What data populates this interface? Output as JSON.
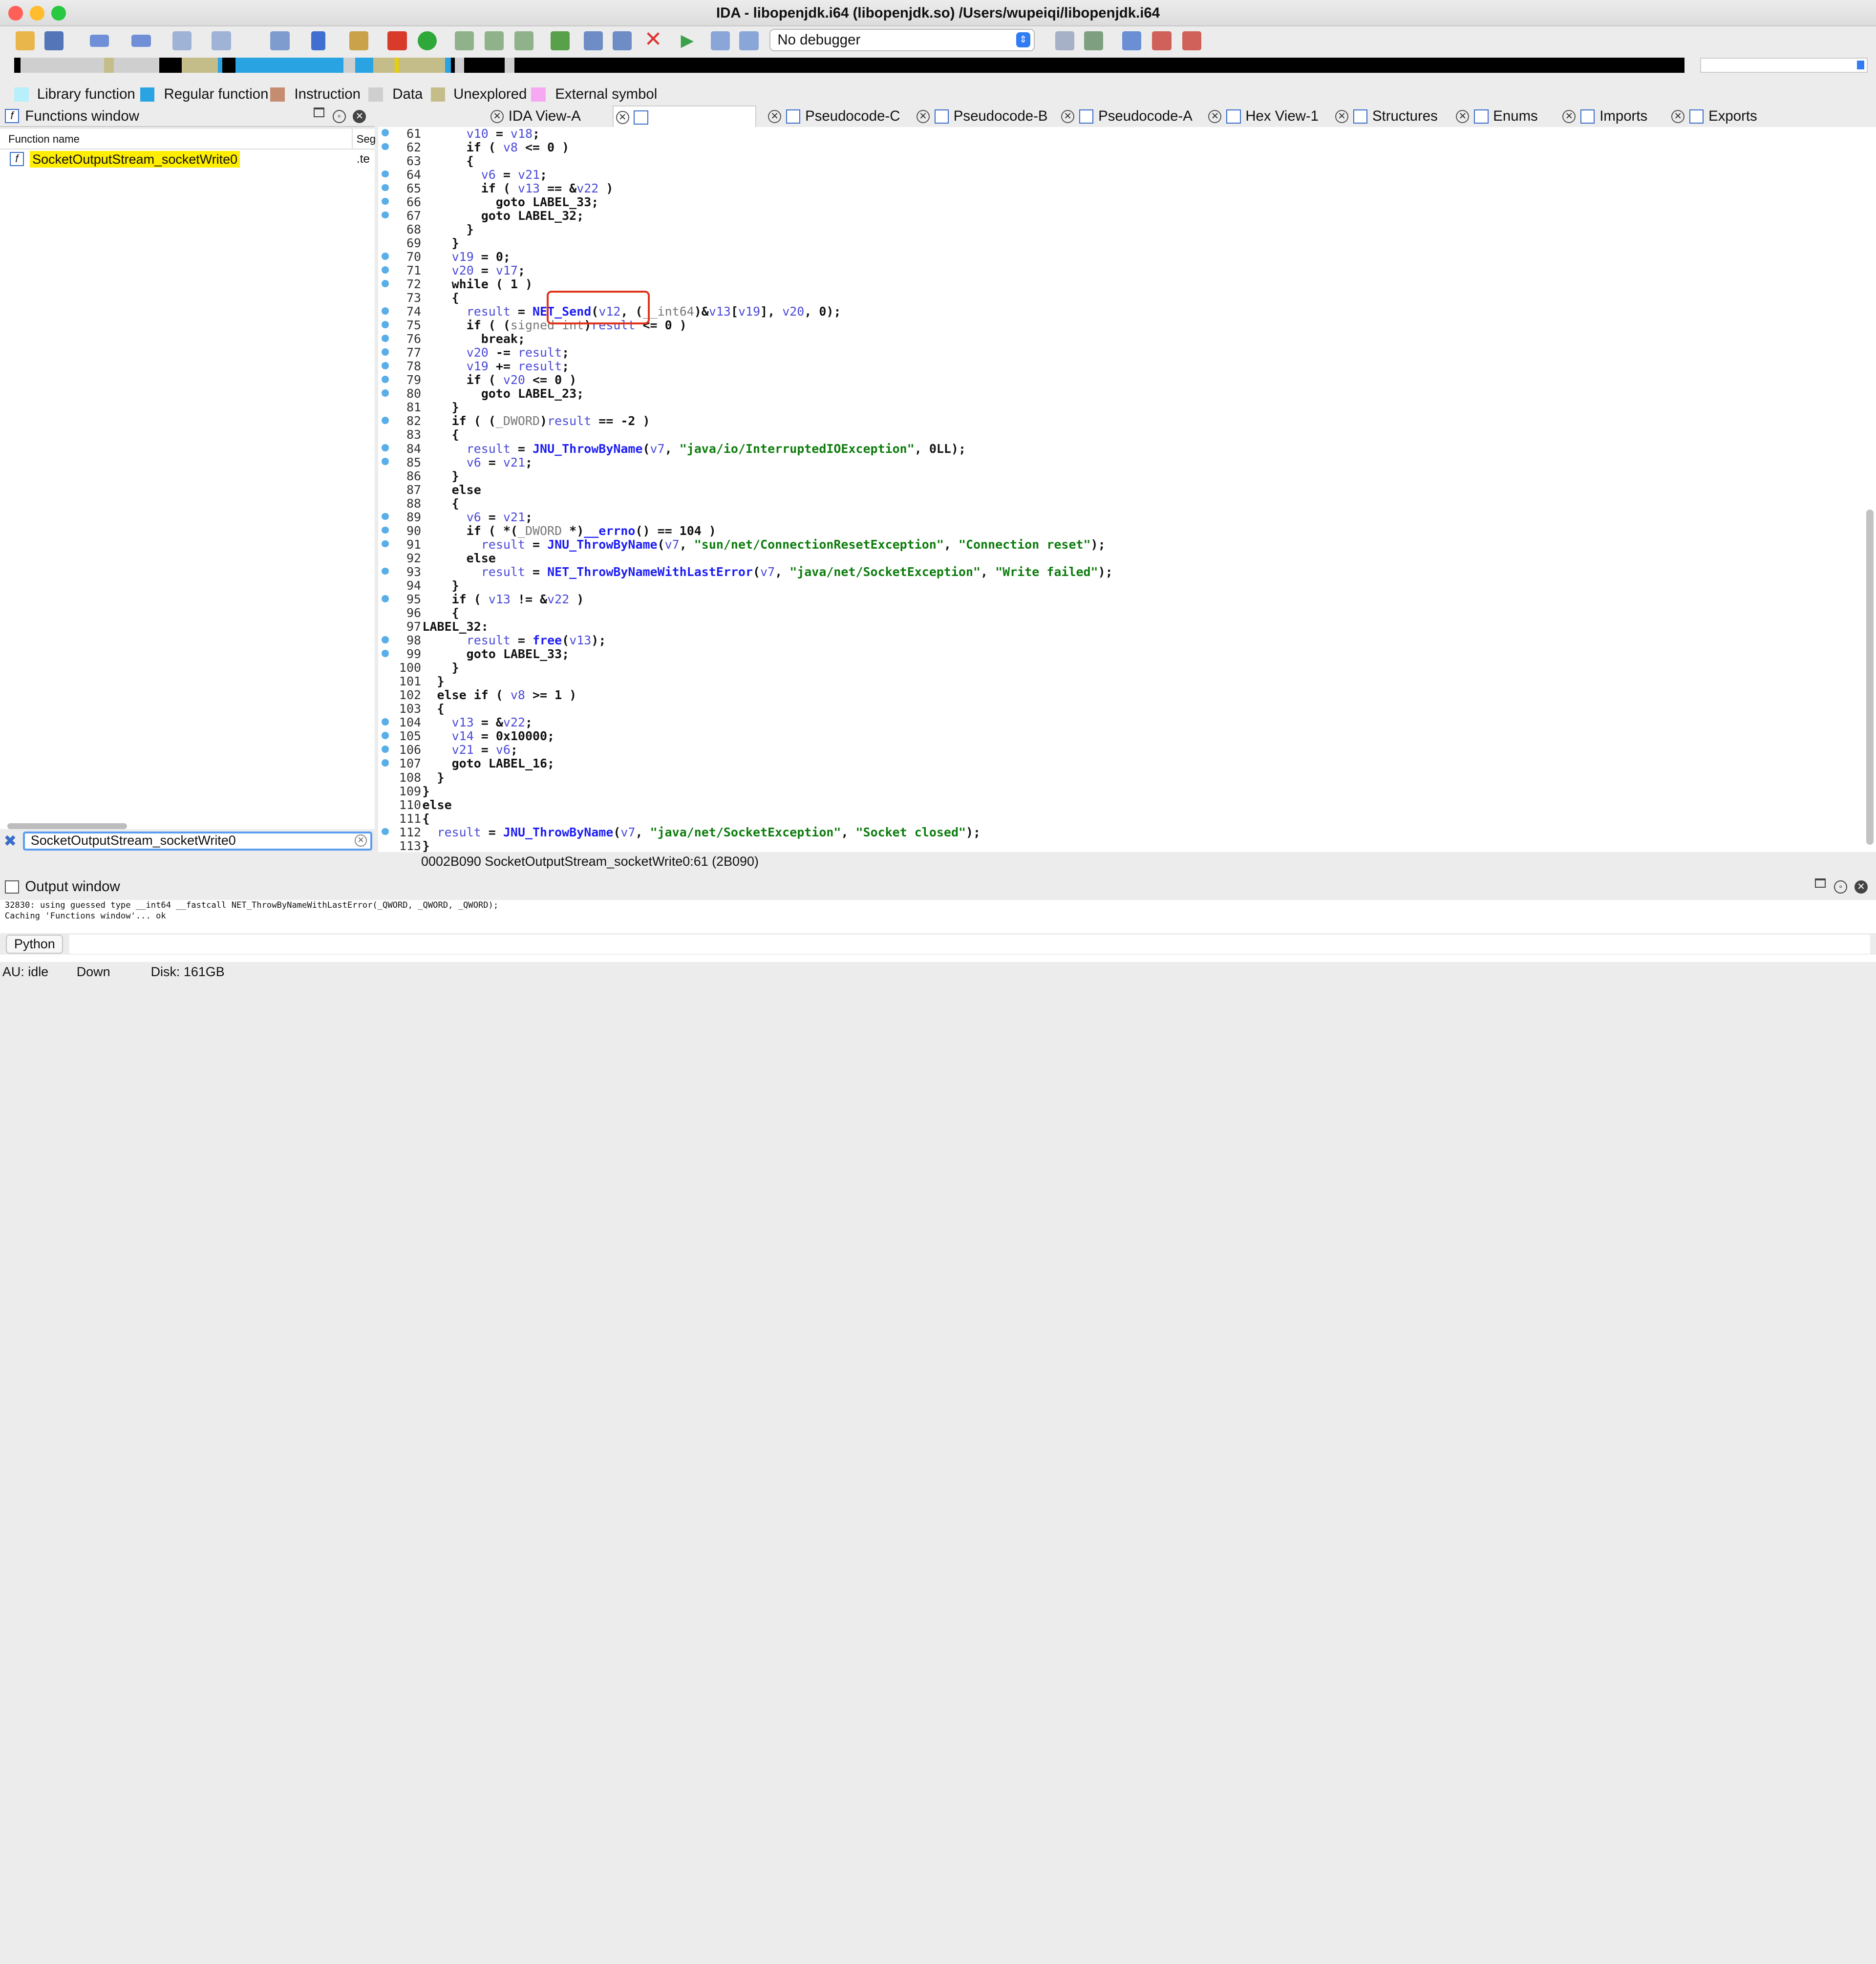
{
  "window": {
    "title": "IDA - libopenjdk.i64 (libopenjdk.so) /Users/wupeiqi/libopenjdk.i64"
  },
  "toolbar": {
    "debugger_select": "No debugger"
  },
  "legend": [
    {
      "label": "Library function",
      "color": "#b7f0fb"
    },
    {
      "label": "Regular function",
      "color": "#2aa3e3"
    },
    {
      "label": "Instruction",
      "color": "#c58c70"
    },
    {
      "label": "Data",
      "color": "#cfcfcf"
    },
    {
      "label": "Unexplored",
      "color": "#c4bd8a"
    },
    {
      "label": "External symbol",
      "color": "#f7a8f2"
    }
  ],
  "functions_window": {
    "title": "Functions window",
    "col_name": "Function name",
    "col_seg": "Seg",
    "rows": [
      {
        "name": "SocketOutputStream_socketWrite0",
        "seg": ".te"
      }
    ],
    "filter_value": "SocketOutputStream_socketWrite0"
  },
  "tabs": [
    {
      "label": "IDA View-A"
    },
    {
      "label": ""
    },
    {
      "label": "Pseudocode-C"
    },
    {
      "label": "Pseudocode-B"
    },
    {
      "label": "Pseudocode-A"
    },
    {
      "label": "Hex View-1"
    },
    {
      "label": "Structures"
    },
    {
      "label": "Enums"
    },
    {
      "label": "Imports"
    },
    {
      "label": "Exports"
    }
  ],
  "code": {
    "lines": [
      {
        "n": "61",
        "bp": true,
        "t": "      v10 = v18;"
      },
      {
        "n": "62",
        "bp": true,
        "t": "      if ( v8 <= 0 )"
      },
      {
        "n": "63",
        "bp": false,
        "t": "      {"
      },
      {
        "n": "64",
        "bp": true,
        "t": "        v6 = v21;"
      },
      {
        "n": "65",
        "bp": true,
        "t": "        if ( v13 == &v22 )"
      },
      {
        "n": "66",
        "bp": true,
        "t": "          goto LABEL_33;"
      },
      {
        "n": "67",
        "bp": true,
        "t": "        goto LABEL_32;"
      },
      {
        "n": "68",
        "bp": false,
        "t": "      }"
      },
      {
        "n": "69",
        "bp": false,
        "t": "    }"
      },
      {
        "n": "70",
        "bp": true,
        "t": "    v19 = 0;"
      },
      {
        "n": "71",
        "bp": true,
        "t": "    v20 = v17;"
      },
      {
        "n": "72",
        "bp": true,
        "t": "    while ( 1 )"
      },
      {
        "n": "73",
        "bp": false,
        "t": "    {"
      },
      {
        "n": "74",
        "bp": true,
        "t": "      result = NET_Send(v12, (__int64)&v13[v19], v20, 0);"
      },
      {
        "n": "75",
        "bp": true,
        "t": "      if ( (signed int)result <= 0 )"
      },
      {
        "n": "76",
        "bp": true,
        "t": "        break;"
      },
      {
        "n": "77",
        "bp": true,
        "t": "      v20 -= result;"
      },
      {
        "n": "78",
        "bp": true,
        "t": "      v19 += result;"
      },
      {
        "n": "79",
        "bp": true,
        "t": "      if ( v20 <= 0 )"
      },
      {
        "n": "80",
        "bp": true,
        "t": "        goto LABEL_23;"
      },
      {
        "n": "81",
        "bp": false,
        "t": "    }"
      },
      {
        "n": "82",
        "bp": true,
        "t": "    if ( (_DWORD)result == -2 )"
      },
      {
        "n": "83",
        "bp": false,
        "t": "    {"
      },
      {
        "n": "84",
        "bp": true,
        "t": "      result = JNU_ThrowByName(v7, \"java/io/InterruptedIOException\", 0LL);"
      },
      {
        "n": "85",
        "bp": true,
        "t": "      v6 = v21;"
      },
      {
        "n": "86",
        "bp": false,
        "t": "    }"
      },
      {
        "n": "87",
        "bp": false,
        "t": "    else"
      },
      {
        "n": "88",
        "bp": false,
        "t": "    {"
      },
      {
        "n": "89",
        "bp": true,
        "t": "      v6 = v21;"
      },
      {
        "n": "90",
        "bp": true,
        "t": "      if ( *(_DWORD *)__errno() == 104 )"
      },
      {
        "n": "91",
        "bp": true,
        "t": "        result = JNU_ThrowByName(v7, \"sun/net/ConnectionResetException\", \"Connection reset\");"
      },
      {
        "n": "92",
        "bp": false,
        "t": "      else"
      },
      {
        "n": "93",
        "bp": true,
        "t": "        result = NET_ThrowByNameWithLastError(v7, \"java/net/SocketException\", \"Write failed\");"
      },
      {
        "n": "94",
        "bp": false,
        "t": "    }"
      },
      {
        "n": "95",
        "bp": true,
        "t": "    if ( v13 != &v22 )"
      },
      {
        "n": "96",
        "bp": false,
        "t": "    {"
      },
      {
        "n": "97",
        "bp": false,
        "t": "LABEL_32:"
      },
      {
        "n": "98",
        "bp": true,
        "t": "      result = free(v13);"
      },
      {
        "n": "99",
        "bp": true,
        "t": "      goto LABEL_33;"
      },
      {
        "n": "100",
        "bp": false,
        "t": "    }"
      },
      {
        "n": "101",
        "bp": false,
        "t": "  }"
      },
      {
        "n": "102",
        "bp": false,
        "t": "  else if ( v8 >= 1 )"
      },
      {
        "n": "103",
        "bp": false,
        "t": "  {"
      },
      {
        "n": "104",
        "bp": true,
        "t": "    v13 = &v22;"
      },
      {
        "n": "105",
        "bp": true,
        "t": "    v14 = 0x10000;"
      },
      {
        "n": "106",
        "bp": true,
        "t": "    v21 = v6;"
      },
      {
        "n": "107",
        "bp": true,
        "t": "    goto LABEL_16;"
      },
      {
        "n": "108",
        "bp": false,
        "t": "  }"
      },
      {
        "n": "109",
        "bp": false,
        "t": "}"
      },
      {
        "n": "110",
        "bp": false,
        "t": "else"
      },
      {
        "n": "111",
        "bp": false,
        "t": "{"
      },
      {
        "n": "112",
        "bp": true,
        "t": "  result = JNU_ThrowByName(v7, \"java/net/SocketException\", \"Socket closed\");"
      },
      {
        "n": "113",
        "bp": false,
        "t": "}"
      }
    ],
    "status": "0002B090  SocketOutputStream_socketWrite0:61 (2B090)"
  },
  "output_window": {
    "title": "Output window",
    "lines": [
      "32830: using guessed type __int64 __fastcall NET_ThrowByNameWithLastError(_QWORD, _QWORD, _QWORD);",
      "Caching 'Functions window'... ok"
    ],
    "python_button": "Python"
  },
  "statusbar": {
    "state": "AU:  idle",
    "direction": "Down",
    "disk": "Disk: 161GB"
  }
}
